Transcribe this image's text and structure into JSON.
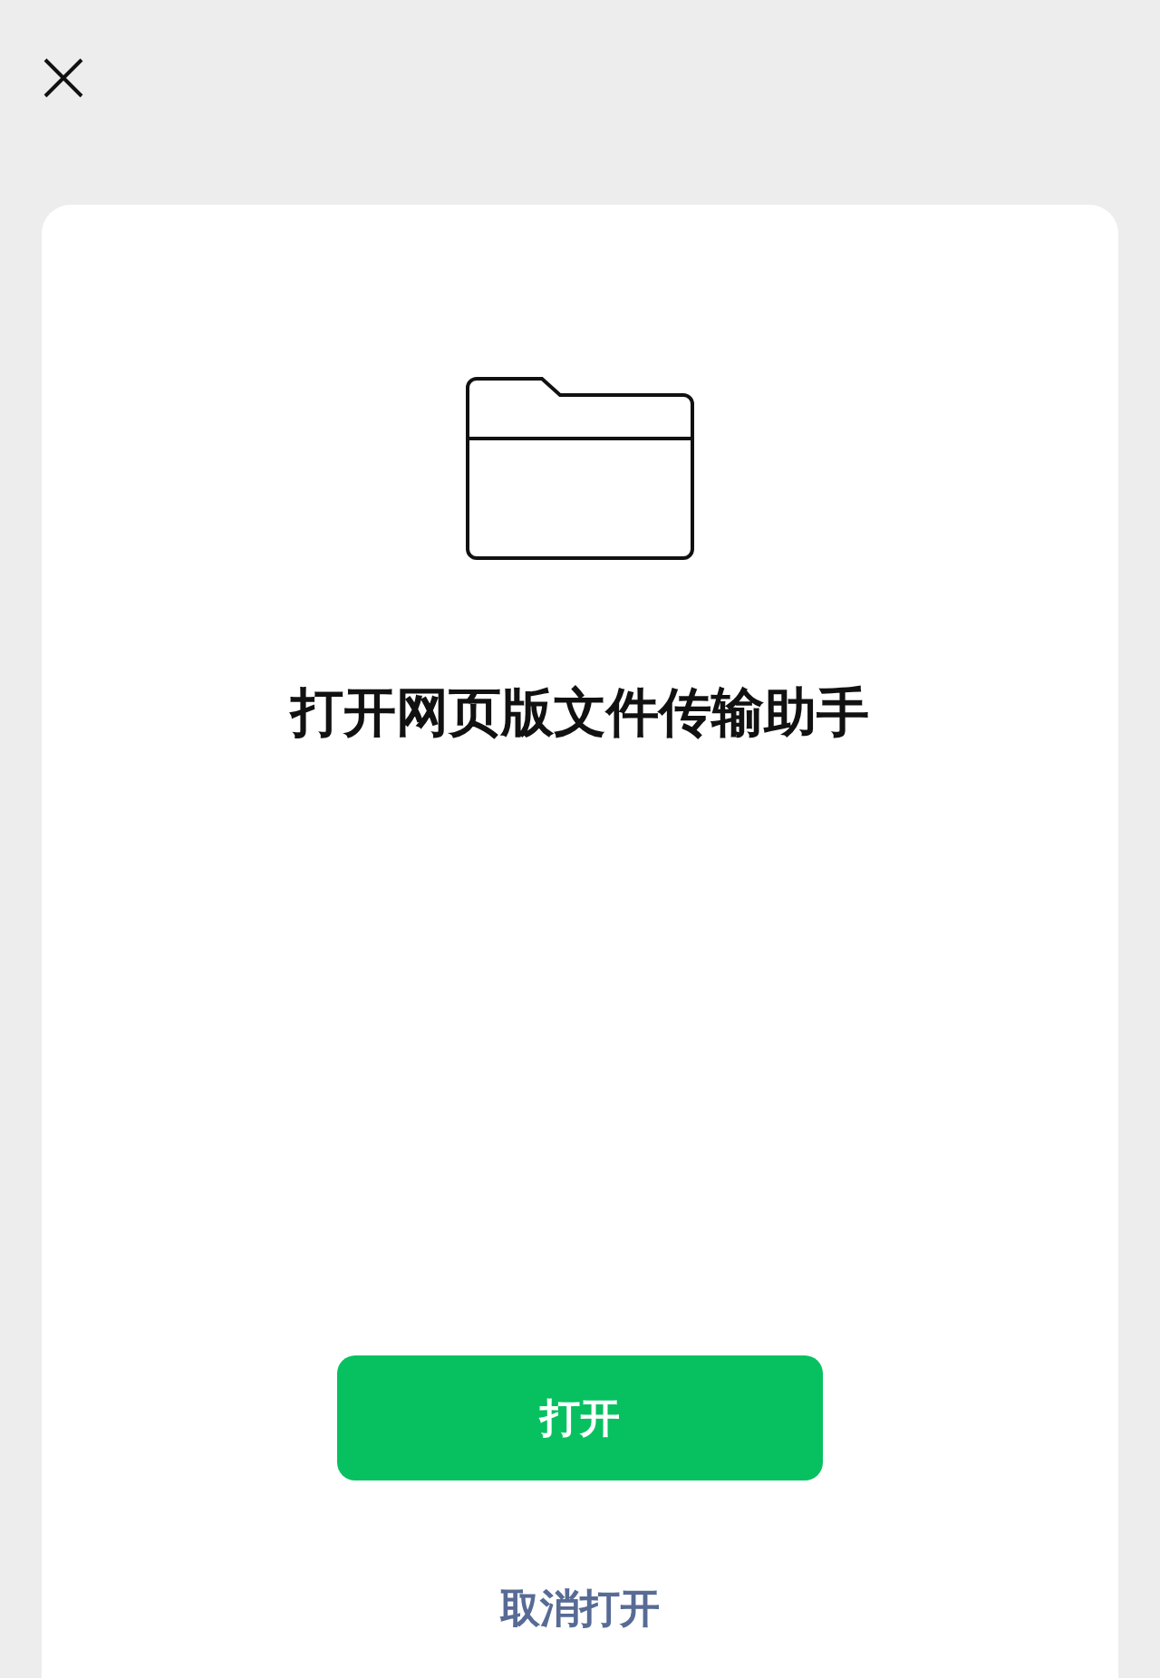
{
  "title": "打开网页版文件传输助手",
  "buttons": [
    {
      "label": "打开",
      "kind": "primary"
    },
    {
      "label": "取消打开",
      "kind": "link"
    }
  ]
}
